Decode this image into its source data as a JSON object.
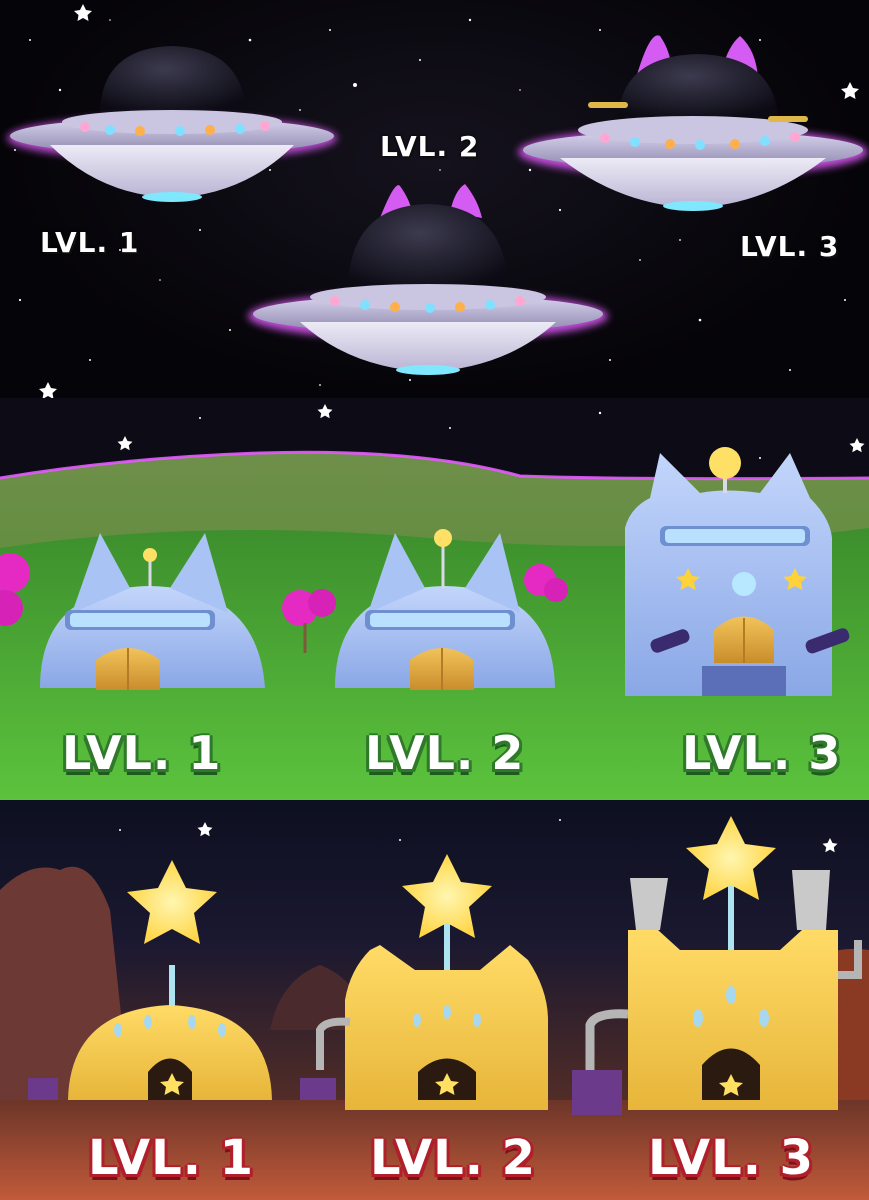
{
  "panels": {
    "ufo": {
      "labels": {
        "lvl1": "LVL. 1",
        "lvl2": "LVL. 2",
        "lvl3": "LVL. 3"
      }
    },
    "cat_houses": {
      "labels": {
        "lvl1": "LVL. 1",
        "lvl2": "LVL. 2",
        "lvl3": "LVL. 3"
      }
    },
    "star_houses": {
      "labels": {
        "lvl1": "LVL. 1",
        "lvl2": "LVL. 2",
        "lvl3": "LVL. 3"
      }
    }
  },
  "colors": {
    "ufo_glow": "#e35bff",
    "ufo_body": "#c9c4df",
    "dome": "#1a1a2a",
    "cat_house": "#a9c3f5",
    "grass": "#4fb33a",
    "star_house": "#f4cc4a",
    "star": "#ffe060",
    "label_green_outline": "#2f7a2a",
    "label_red_outline": "#b01f2a"
  }
}
